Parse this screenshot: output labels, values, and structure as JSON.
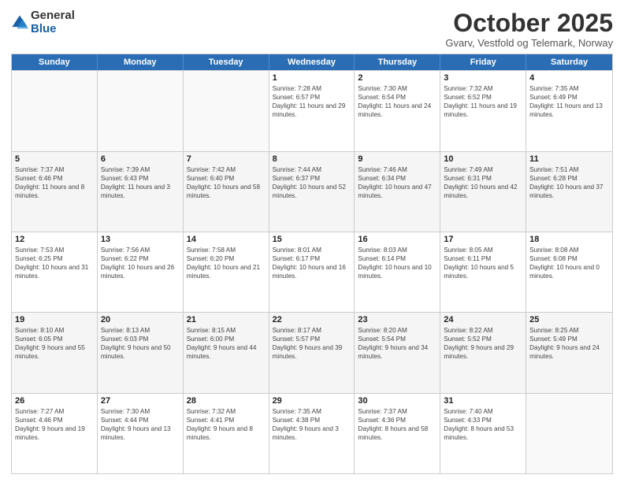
{
  "logo": {
    "general": "General",
    "blue": "Blue"
  },
  "title": "October 2025",
  "subtitle": "Gvarv, Vestfold og Telemark, Norway",
  "days": [
    "Sunday",
    "Monday",
    "Tuesday",
    "Wednesday",
    "Thursday",
    "Friday",
    "Saturday"
  ],
  "rows": [
    [
      {
        "day": "",
        "sunrise": "",
        "sunset": "",
        "daylight": ""
      },
      {
        "day": "",
        "sunrise": "",
        "sunset": "",
        "daylight": ""
      },
      {
        "day": "",
        "sunrise": "",
        "sunset": "",
        "daylight": ""
      },
      {
        "day": "1",
        "sunrise": "Sunrise: 7:28 AM",
        "sunset": "Sunset: 6:57 PM",
        "daylight": "Daylight: 11 hours and 29 minutes."
      },
      {
        "day": "2",
        "sunrise": "Sunrise: 7:30 AM",
        "sunset": "Sunset: 6:54 PM",
        "daylight": "Daylight: 11 hours and 24 minutes."
      },
      {
        "day": "3",
        "sunrise": "Sunrise: 7:32 AM",
        "sunset": "Sunset: 6:52 PM",
        "daylight": "Daylight: 11 hours and 19 minutes."
      },
      {
        "day": "4",
        "sunrise": "Sunrise: 7:35 AM",
        "sunset": "Sunset: 6:49 PM",
        "daylight": "Daylight: 11 hours and 13 minutes."
      }
    ],
    [
      {
        "day": "5",
        "sunrise": "Sunrise: 7:37 AM",
        "sunset": "Sunset: 6:46 PM",
        "daylight": "Daylight: 11 hours and 8 minutes."
      },
      {
        "day": "6",
        "sunrise": "Sunrise: 7:39 AM",
        "sunset": "Sunset: 6:43 PM",
        "daylight": "Daylight: 11 hours and 3 minutes."
      },
      {
        "day": "7",
        "sunrise": "Sunrise: 7:42 AM",
        "sunset": "Sunset: 6:40 PM",
        "daylight": "Daylight: 10 hours and 58 minutes."
      },
      {
        "day": "8",
        "sunrise": "Sunrise: 7:44 AM",
        "sunset": "Sunset: 6:37 PM",
        "daylight": "Daylight: 10 hours and 52 minutes."
      },
      {
        "day": "9",
        "sunrise": "Sunrise: 7:46 AM",
        "sunset": "Sunset: 6:34 PM",
        "daylight": "Daylight: 10 hours and 47 minutes."
      },
      {
        "day": "10",
        "sunrise": "Sunrise: 7:49 AM",
        "sunset": "Sunset: 6:31 PM",
        "daylight": "Daylight: 10 hours and 42 minutes."
      },
      {
        "day": "11",
        "sunrise": "Sunrise: 7:51 AM",
        "sunset": "Sunset: 6:28 PM",
        "daylight": "Daylight: 10 hours and 37 minutes."
      }
    ],
    [
      {
        "day": "12",
        "sunrise": "Sunrise: 7:53 AM",
        "sunset": "Sunset: 6:25 PM",
        "daylight": "Daylight: 10 hours and 31 minutes."
      },
      {
        "day": "13",
        "sunrise": "Sunrise: 7:56 AM",
        "sunset": "Sunset: 6:22 PM",
        "daylight": "Daylight: 10 hours and 26 minutes."
      },
      {
        "day": "14",
        "sunrise": "Sunrise: 7:58 AM",
        "sunset": "Sunset: 6:20 PM",
        "daylight": "Daylight: 10 hours and 21 minutes."
      },
      {
        "day": "15",
        "sunrise": "Sunrise: 8:01 AM",
        "sunset": "Sunset: 6:17 PM",
        "daylight": "Daylight: 10 hours and 16 minutes."
      },
      {
        "day": "16",
        "sunrise": "Sunrise: 8:03 AM",
        "sunset": "Sunset: 6:14 PM",
        "daylight": "Daylight: 10 hours and 10 minutes."
      },
      {
        "day": "17",
        "sunrise": "Sunrise: 8:05 AM",
        "sunset": "Sunset: 6:11 PM",
        "daylight": "Daylight: 10 hours and 5 minutes."
      },
      {
        "day": "18",
        "sunrise": "Sunrise: 8:08 AM",
        "sunset": "Sunset: 6:08 PM",
        "daylight": "Daylight: 10 hours and 0 minutes."
      }
    ],
    [
      {
        "day": "19",
        "sunrise": "Sunrise: 8:10 AM",
        "sunset": "Sunset: 6:05 PM",
        "daylight": "Daylight: 9 hours and 55 minutes."
      },
      {
        "day": "20",
        "sunrise": "Sunrise: 8:13 AM",
        "sunset": "Sunset: 6:03 PM",
        "daylight": "Daylight: 9 hours and 50 minutes."
      },
      {
        "day": "21",
        "sunrise": "Sunrise: 8:15 AM",
        "sunset": "Sunset: 6:00 PM",
        "daylight": "Daylight: 9 hours and 44 minutes."
      },
      {
        "day": "22",
        "sunrise": "Sunrise: 8:17 AM",
        "sunset": "Sunset: 5:57 PM",
        "daylight": "Daylight: 9 hours and 39 minutes."
      },
      {
        "day": "23",
        "sunrise": "Sunrise: 8:20 AM",
        "sunset": "Sunset: 5:54 PM",
        "daylight": "Daylight: 9 hours and 34 minutes."
      },
      {
        "day": "24",
        "sunrise": "Sunrise: 8:22 AM",
        "sunset": "Sunset: 5:52 PM",
        "daylight": "Daylight: 9 hours and 29 minutes."
      },
      {
        "day": "25",
        "sunrise": "Sunrise: 8:25 AM",
        "sunset": "Sunset: 5:49 PM",
        "daylight": "Daylight: 9 hours and 24 minutes."
      }
    ],
    [
      {
        "day": "26",
        "sunrise": "Sunrise: 7:27 AM",
        "sunset": "Sunset: 4:46 PM",
        "daylight": "Daylight: 9 hours and 19 minutes."
      },
      {
        "day": "27",
        "sunrise": "Sunrise: 7:30 AM",
        "sunset": "Sunset: 4:44 PM",
        "daylight": "Daylight: 9 hours and 13 minutes."
      },
      {
        "day": "28",
        "sunrise": "Sunrise: 7:32 AM",
        "sunset": "Sunset: 4:41 PM",
        "daylight": "Daylight: 9 hours and 8 minutes."
      },
      {
        "day": "29",
        "sunrise": "Sunrise: 7:35 AM",
        "sunset": "Sunset: 4:38 PM",
        "daylight": "Daylight: 9 hours and 3 minutes."
      },
      {
        "day": "30",
        "sunrise": "Sunrise: 7:37 AM",
        "sunset": "Sunset: 4:36 PM",
        "daylight": "Daylight: 8 hours and 58 minutes."
      },
      {
        "day": "31",
        "sunrise": "Sunrise: 7:40 AM",
        "sunset": "Sunset: 4:33 PM",
        "daylight": "Daylight: 8 hours and 53 minutes."
      },
      {
        "day": "",
        "sunrise": "",
        "sunset": "",
        "daylight": ""
      }
    ]
  ]
}
